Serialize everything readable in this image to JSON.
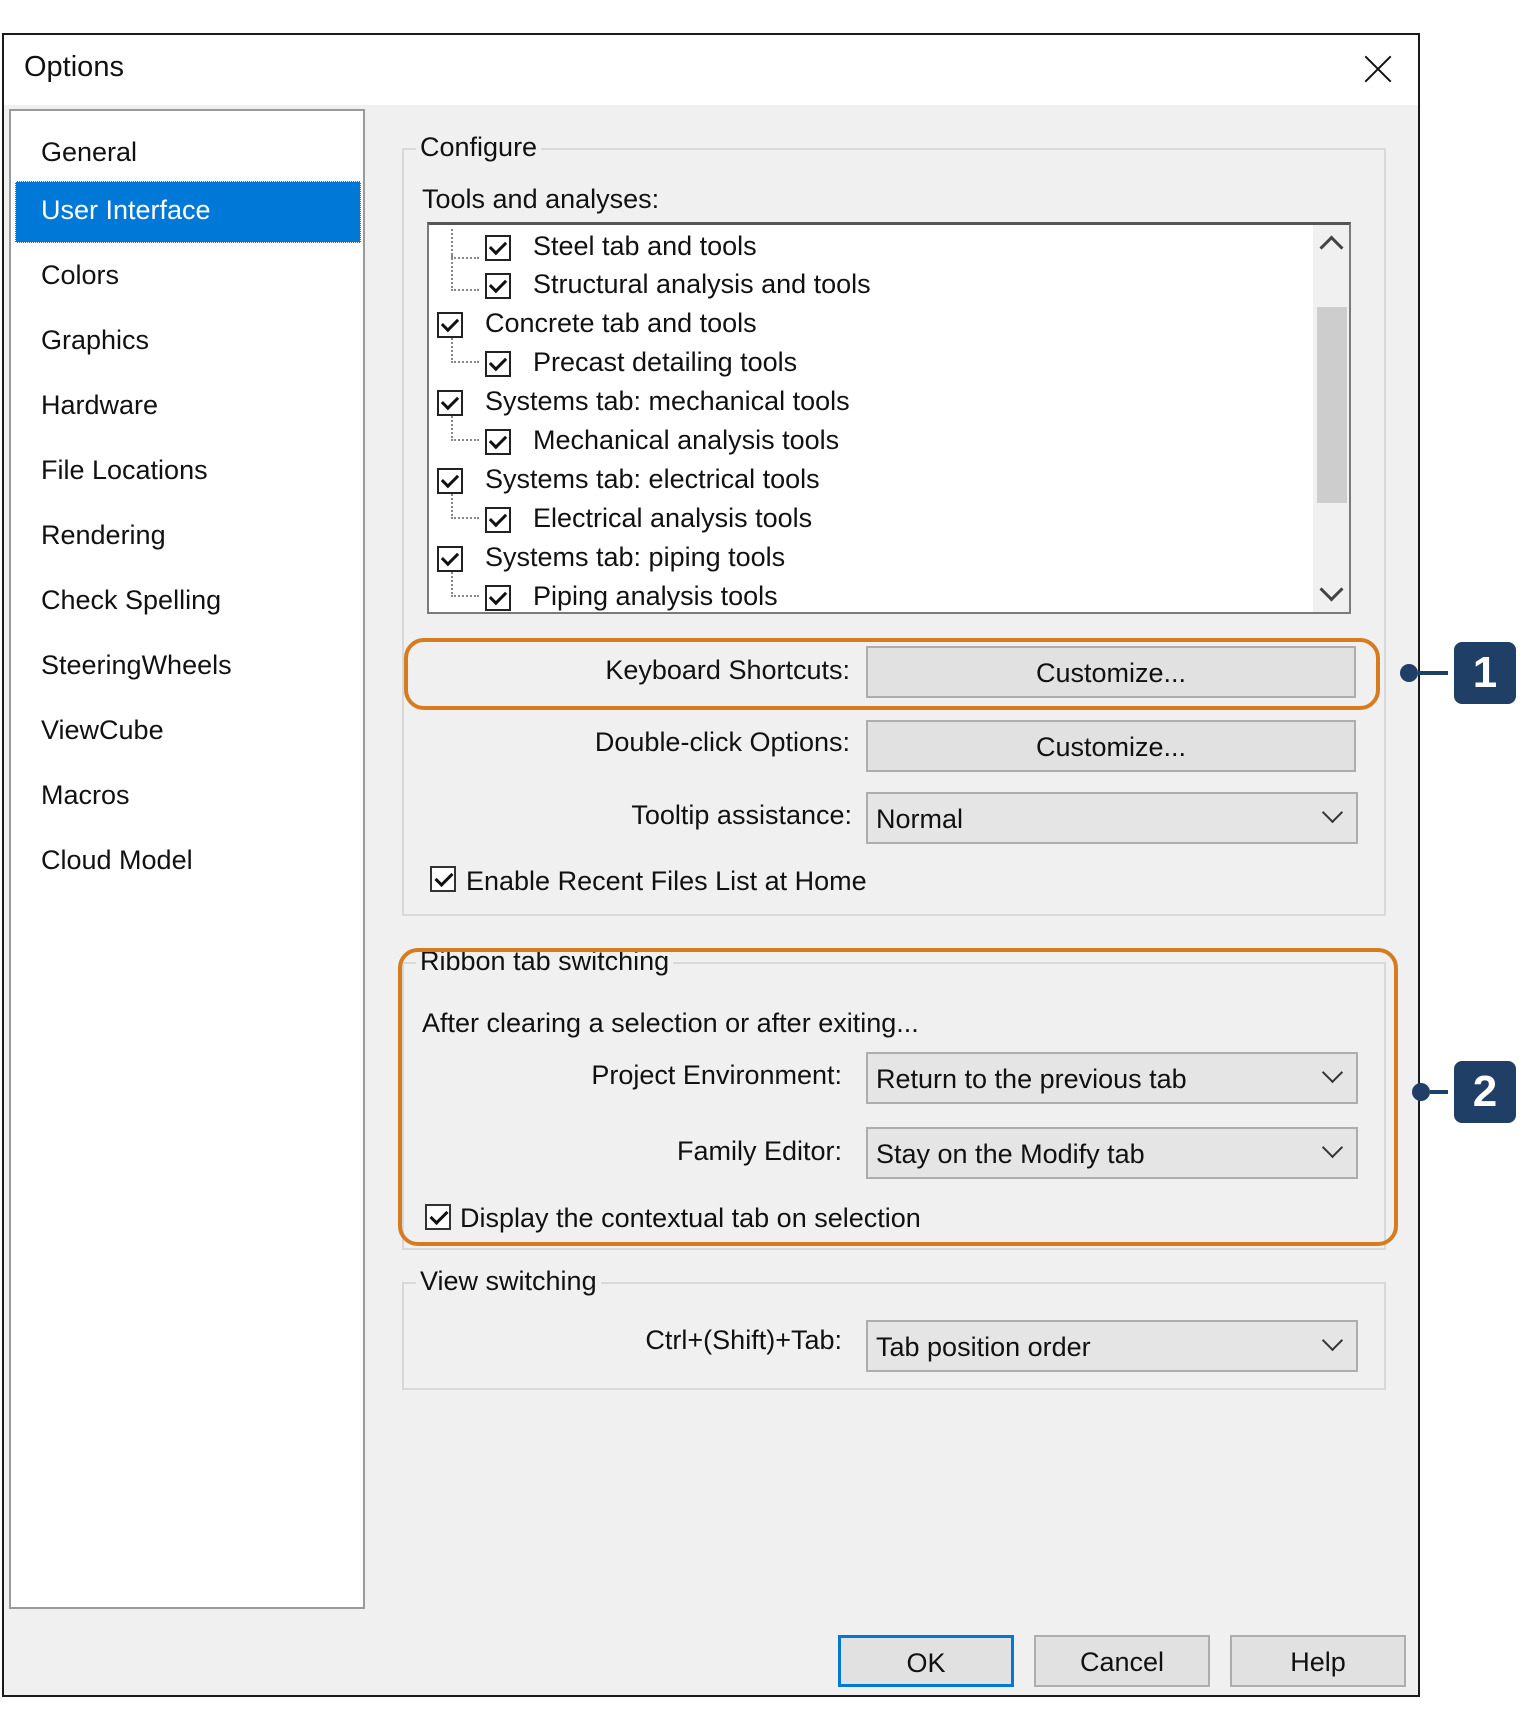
{
  "dialog": {
    "title": "Options"
  },
  "sidebar": {
    "items": [
      {
        "label": "General"
      },
      {
        "label": "User Interface",
        "selected": true
      },
      {
        "label": "Colors"
      },
      {
        "label": "Graphics"
      },
      {
        "label": "Hardware"
      },
      {
        "label": "File Locations"
      },
      {
        "label": "Rendering"
      },
      {
        "label": "Check Spelling"
      },
      {
        "label": "SteeringWheels"
      },
      {
        "label": "ViewCube"
      },
      {
        "label": "Macros"
      },
      {
        "label": "Cloud Model"
      }
    ]
  },
  "configure": {
    "legend": "Configure",
    "tools_label": "Tools and analyses:",
    "tree": [
      {
        "label": "Steel tab and tools",
        "checked": true
      },
      {
        "label": "Structural analysis and tools",
        "checked": true
      },
      {
        "label": "Concrete tab and tools",
        "checked": true
      },
      {
        "label": "Precast detailing tools",
        "checked": true
      },
      {
        "label": "Systems tab: mechanical tools",
        "checked": true
      },
      {
        "label": "Mechanical analysis tools",
        "checked": true
      },
      {
        "label": "Systems tab: electrical tools",
        "checked": true
      },
      {
        "label": "Electrical analysis tools",
        "checked": true
      },
      {
        "label": "Systems tab: piping tools",
        "checked": true
      },
      {
        "label": "Piping analysis tools",
        "checked": true
      }
    ],
    "keyboard_label": "Keyboard Shortcuts:",
    "keyboard_button": "Customize...",
    "doubleclick_label": "Double-click Options:",
    "doubleclick_button": "Customize...",
    "tooltip_label": "Tooltip assistance:",
    "tooltip_value": "Normal",
    "recent_files_label": "Enable Recent Files List at Home",
    "recent_files_checked": true
  },
  "ribbon": {
    "legend": "Ribbon tab switching",
    "intro": "After clearing a selection or after exiting...",
    "project_label": "Project Environment:",
    "project_value": "Return to the previous tab",
    "family_label": "Family Editor:",
    "family_value": "Stay on the Modify tab",
    "contextual_label": "Display the contextual tab on selection",
    "contextual_checked": true
  },
  "view": {
    "legend": "View switching",
    "ctrl_label": "Ctrl+(Shift)+Tab:",
    "ctrl_value": "Tab position order"
  },
  "footer": {
    "ok": "OK",
    "cancel": "Cancel",
    "help": "Help"
  },
  "callouts": {
    "one": "1",
    "two": "2"
  },
  "colors": {
    "accent": "#0078d7",
    "highlight": "#d67b1f",
    "badge": "#1f3f66"
  }
}
